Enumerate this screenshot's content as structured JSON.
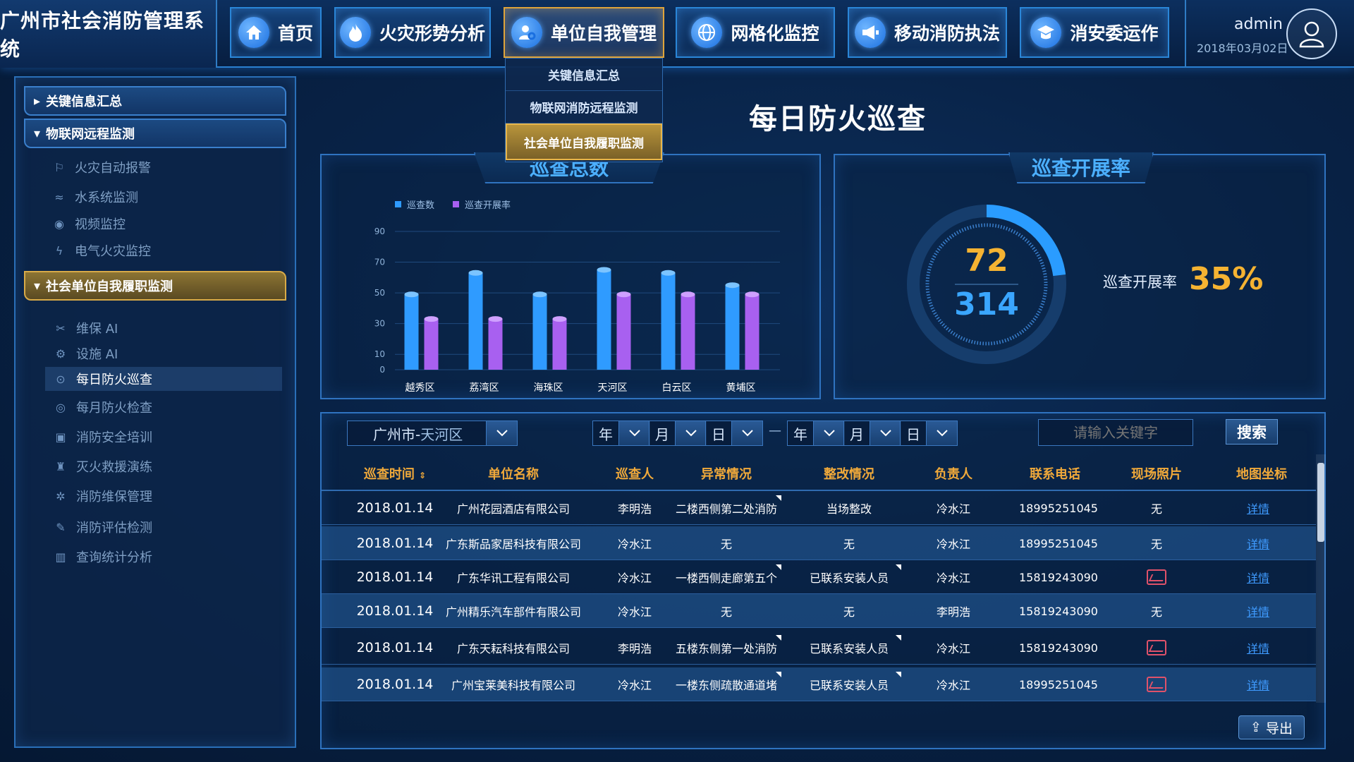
{
  "app": {
    "title": "广州市社会消防管理系统"
  },
  "nav": {
    "tabs": [
      {
        "label": "首页",
        "icon": "home-icon"
      },
      {
        "label": "火灾形势分析",
        "icon": "fire-icon"
      },
      {
        "label": "单位自我管理",
        "icon": "user-gear-icon",
        "active": true
      },
      {
        "label": "网格化监控",
        "icon": "globe-icon"
      },
      {
        "label": "移动消防执法",
        "icon": "megaphone-icon"
      },
      {
        "label": "消安委运作",
        "icon": "academy-icon"
      }
    ],
    "dropdown": [
      "关键信息汇总",
      "物联网消防远程监测",
      "社会单位自我履职监测"
    ]
  },
  "user": {
    "name": "admin",
    "date": "2018年03月02日"
  },
  "sidebar": {
    "groups": [
      {
        "label": "关键信息汇总"
      },
      {
        "label": "物联网远程监测"
      },
      {
        "label": "社会单位自我履职监测"
      }
    ],
    "iot_items": [
      "火灾自动报警",
      "水系统监测",
      "视频监控",
      "电气火灾监控"
    ],
    "duty_items": [
      "维保 AI",
      "设施 AI",
      "每日防火巡查",
      "每月防火检查",
      "消防安全培训",
      "灭火救援演练",
      "消防维保管理",
      "消防评估检测",
      "查询统计分析"
    ]
  },
  "page": {
    "title": "每日防火巡查"
  },
  "bar_panel": {
    "tab_label": "巡查总数"
  },
  "rate_panel": {
    "tab_label": "巡查开展率",
    "done": "72",
    "total": "314",
    "rate_label": "巡查开展率",
    "rate_value": "35%",
    "rate_fraction": 0.23
  },
  "chart_data": {
    "type": "bar",
    "categories": [
      "越秀区",
      "荔湾区",
      "海珠区",
      "天河区",
      "白云区",
      "黄埔区"
    ],
    "series": [
      {
        "name": "巡查数",
        "values": [
          49,
          63,
          49,
          65,
          63,
          55
        ],
        "color": "#2f9bff"
      },
      {
        "name": "巡查开展率",
        "values": [
          33,
          33,
          33,
          49,
          49,
          49
        ],
        "color": "#a860f0"
      }
    ],
    "y_ticks": [
      0,
      10,
      30,
      50,
      70,
      90
    ],
    "ylim": [
      0,
      90
    ],
    "grid": true,
    "legend_position": "top-left"
  },
  "filters": {
    "region_city": "广州市-",
    "region_district": "天河区",
    "year": "年",
    "month": "月",
    "day": "日",
    "dash": "—",
    "search_placeholder": "请输入关键字",
    "search_label": "搜索",
    "export_label": "导出"
  },
  "table": {
    "columns": [
      "巡查时间",
      "单位名称",
      "巡查人",
      "异常情况",
      "整改情况",
      "负责人",
      "联系电话",
      "现场照片",
      "地图坐标"
    ],
    "rows": [
      {
        "time": "2018.01.14",
        "unit": "广州花园酒店有限公司",
        "inspector": "李明浩",
        "abnormal": "二楼西侧第二处消防",
        "rectify": "当场整改",
        "owner": "冷水江",
        "phone": "18995251045",
        "photo": "无",
        "map": "详情"
      },
      {
        "time": "2018.01.14",
        "unit": "广东斯品家居科技有限公司",
        "inspector": "冷水江",
        "abnormal": "无",
        "rectify": "无",
        "owner": "冷水江",
        "phone": "18995251045",
        "photo": "无",
        "map": "详情"
      },
      {
        "time": "2018.01.14",
        "unit": "广东华讯工程有限公司",
        "inspector": "冷水江",
        "abnormal": "一楼西侧走廊第五个",
        "rectify": "已联系安装人员",
        "owner": "冷水江",
        "phone": "15819243090",
        "photo": "",
        "map": "详情"
      },
      {
        "time": "2018.01.14",
        "unit": "广州精乐汽车部件有限公司",
        "inspector": "冷水江",
        "abnormal": "无",
        "rectify": "无",
        "owner": "李明浩",
        "phone": "15819243090",
        "photo": "无",
        "map": "详情"
      },
      {
        "time": "2018.01.14",
        "unit": "广东天耘科技有限公司",
        "inspector": "李明浩",
        "abnormal": "五楼东侧第一处消防",
        "rectify": "已联系安装人员",
        "owner": "冷水江",
        "phone": "15819243090",
        "photo": "",
        "map": "详情"
      },
      {
        "time": "2018.01.14",
        "unit": "广州宝莱美科技有限公司",
        "inspector": "冷水江",
        "abnormal": "一楼东侧疏散通道堵",
        "rectify": "已联系安装人员",
        "owner": "冷水江",
        "phone": "18995251045",
        "photo": "",
        "map": "详情"
      }
    ]
  }
}
